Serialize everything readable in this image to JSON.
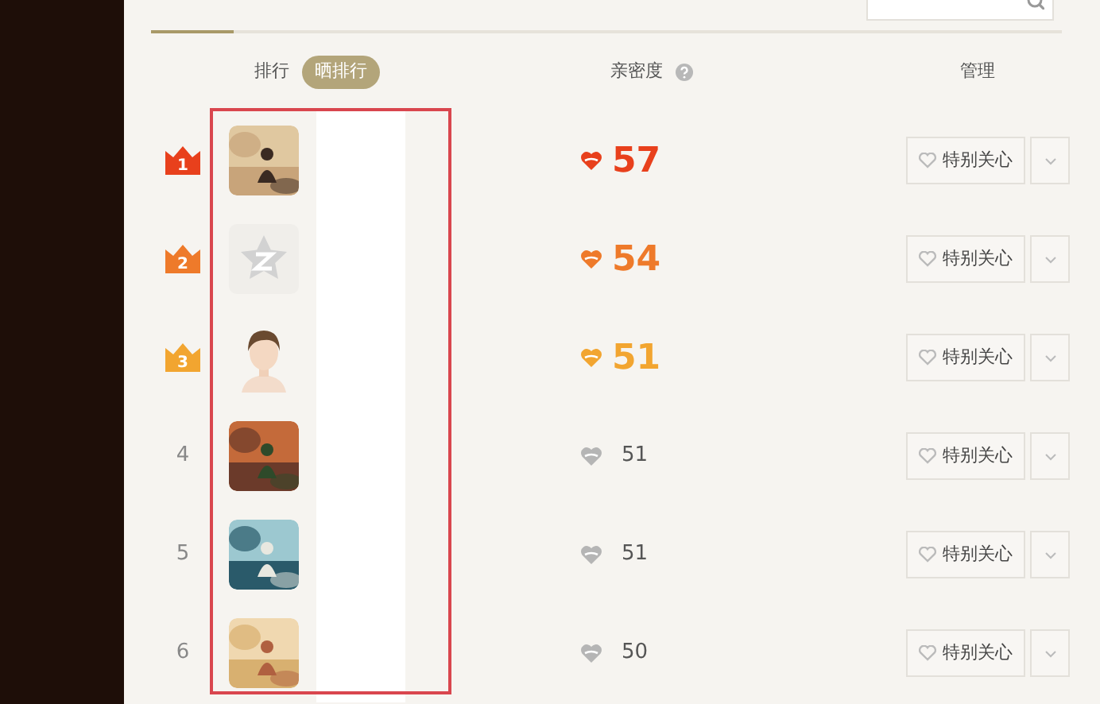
{
  "tabs": [
    {
      "selected": true
    }
  ],
  "columns": {
    "rank": "排行",
    "share": "晒排行",
    "intimacy": "亲密度",
    "manage": "管理"
  },
  "rows": [
    {
      "rank": "1",
      "kind": "crown",
      "color": "#e8401c",
      "score": "57",
      "button": "特别关心"
    },
    {
      "rank": "2",
      "kind": "crown",
      "color": "#ee7a2a",
      "avatar": {
        "kind": "default_icon"
      },
      "score": "54",
      "button": "特别关心"
    },
    {
      "rank": "3",
      "kind": "crown",
      "color": "#f2a530",
      "avatar": {
        "kind": "figure"
      },
      "score": "51",
      "button": "特别关心"
    },
    {
      "rank": "4",
      "kind": "plain",
      "score": "51",
      "button": "特别关心"
    },
    {
      "rank": "5",
      "kind": "plain",
      "score": "51",
      "button": "特别关心"
    },
    {
      "rank": "6",
      "kind": "plain",
      "score": "50",
      "button": "特别关心"
    }
  ]
}
